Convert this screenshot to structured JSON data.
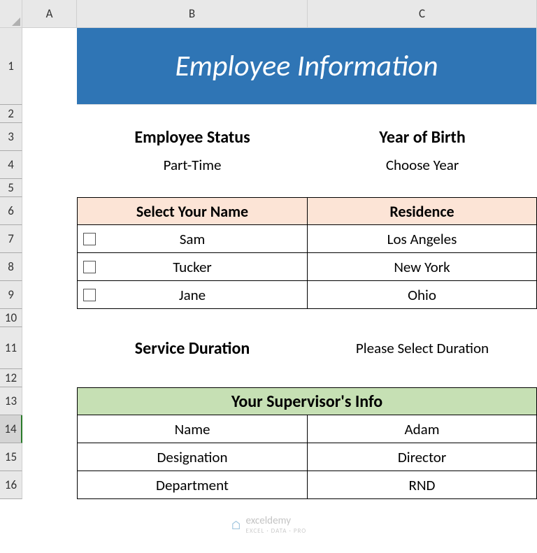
{
  "cols": [
    "A",
    "B",
    "C"
  ],
  "rows": [
    "1",
    "2",
    "3",
    "4",
    "5",
    "6",
    "7",
    "8",
    "9",
    "10",
    "11",
    "12",
    "13",
    "14",
    "15",
    "16"
  ],
  "title": "Employee Information",
  "status_hdr": "Employee Status",
  "status_val": "Part-Time",
  "yob_hdr": "Year of Birth",
  "yob_val": "Choose Year",
  "name_hdr": "Select Your Name",
  "res_hdr": "Residence",
  "names": [
    "Sam",
    "Tucker",
    "Jane"
  ],
  "residences": [
    "Los Angeles",
    "New York",
    "Ohio"
  ],
  "svc_hdr": "Service Duration",
  "svc_val": "Please Select Duration",
  "sup_hdr": "Your Supervisor's Info",
  "sup_rows": [
    {
      "k": "Name",
      "v": "Adam"
    },
    {
      "k": "Designation",
      "v": "Director"
    },
    {
      "k": "Department",
      "v": "RND"
    }
  ],
  "watermark": "exceldemy",
  "watermark_sub": "EXCEL · DATA · PRO"
}
